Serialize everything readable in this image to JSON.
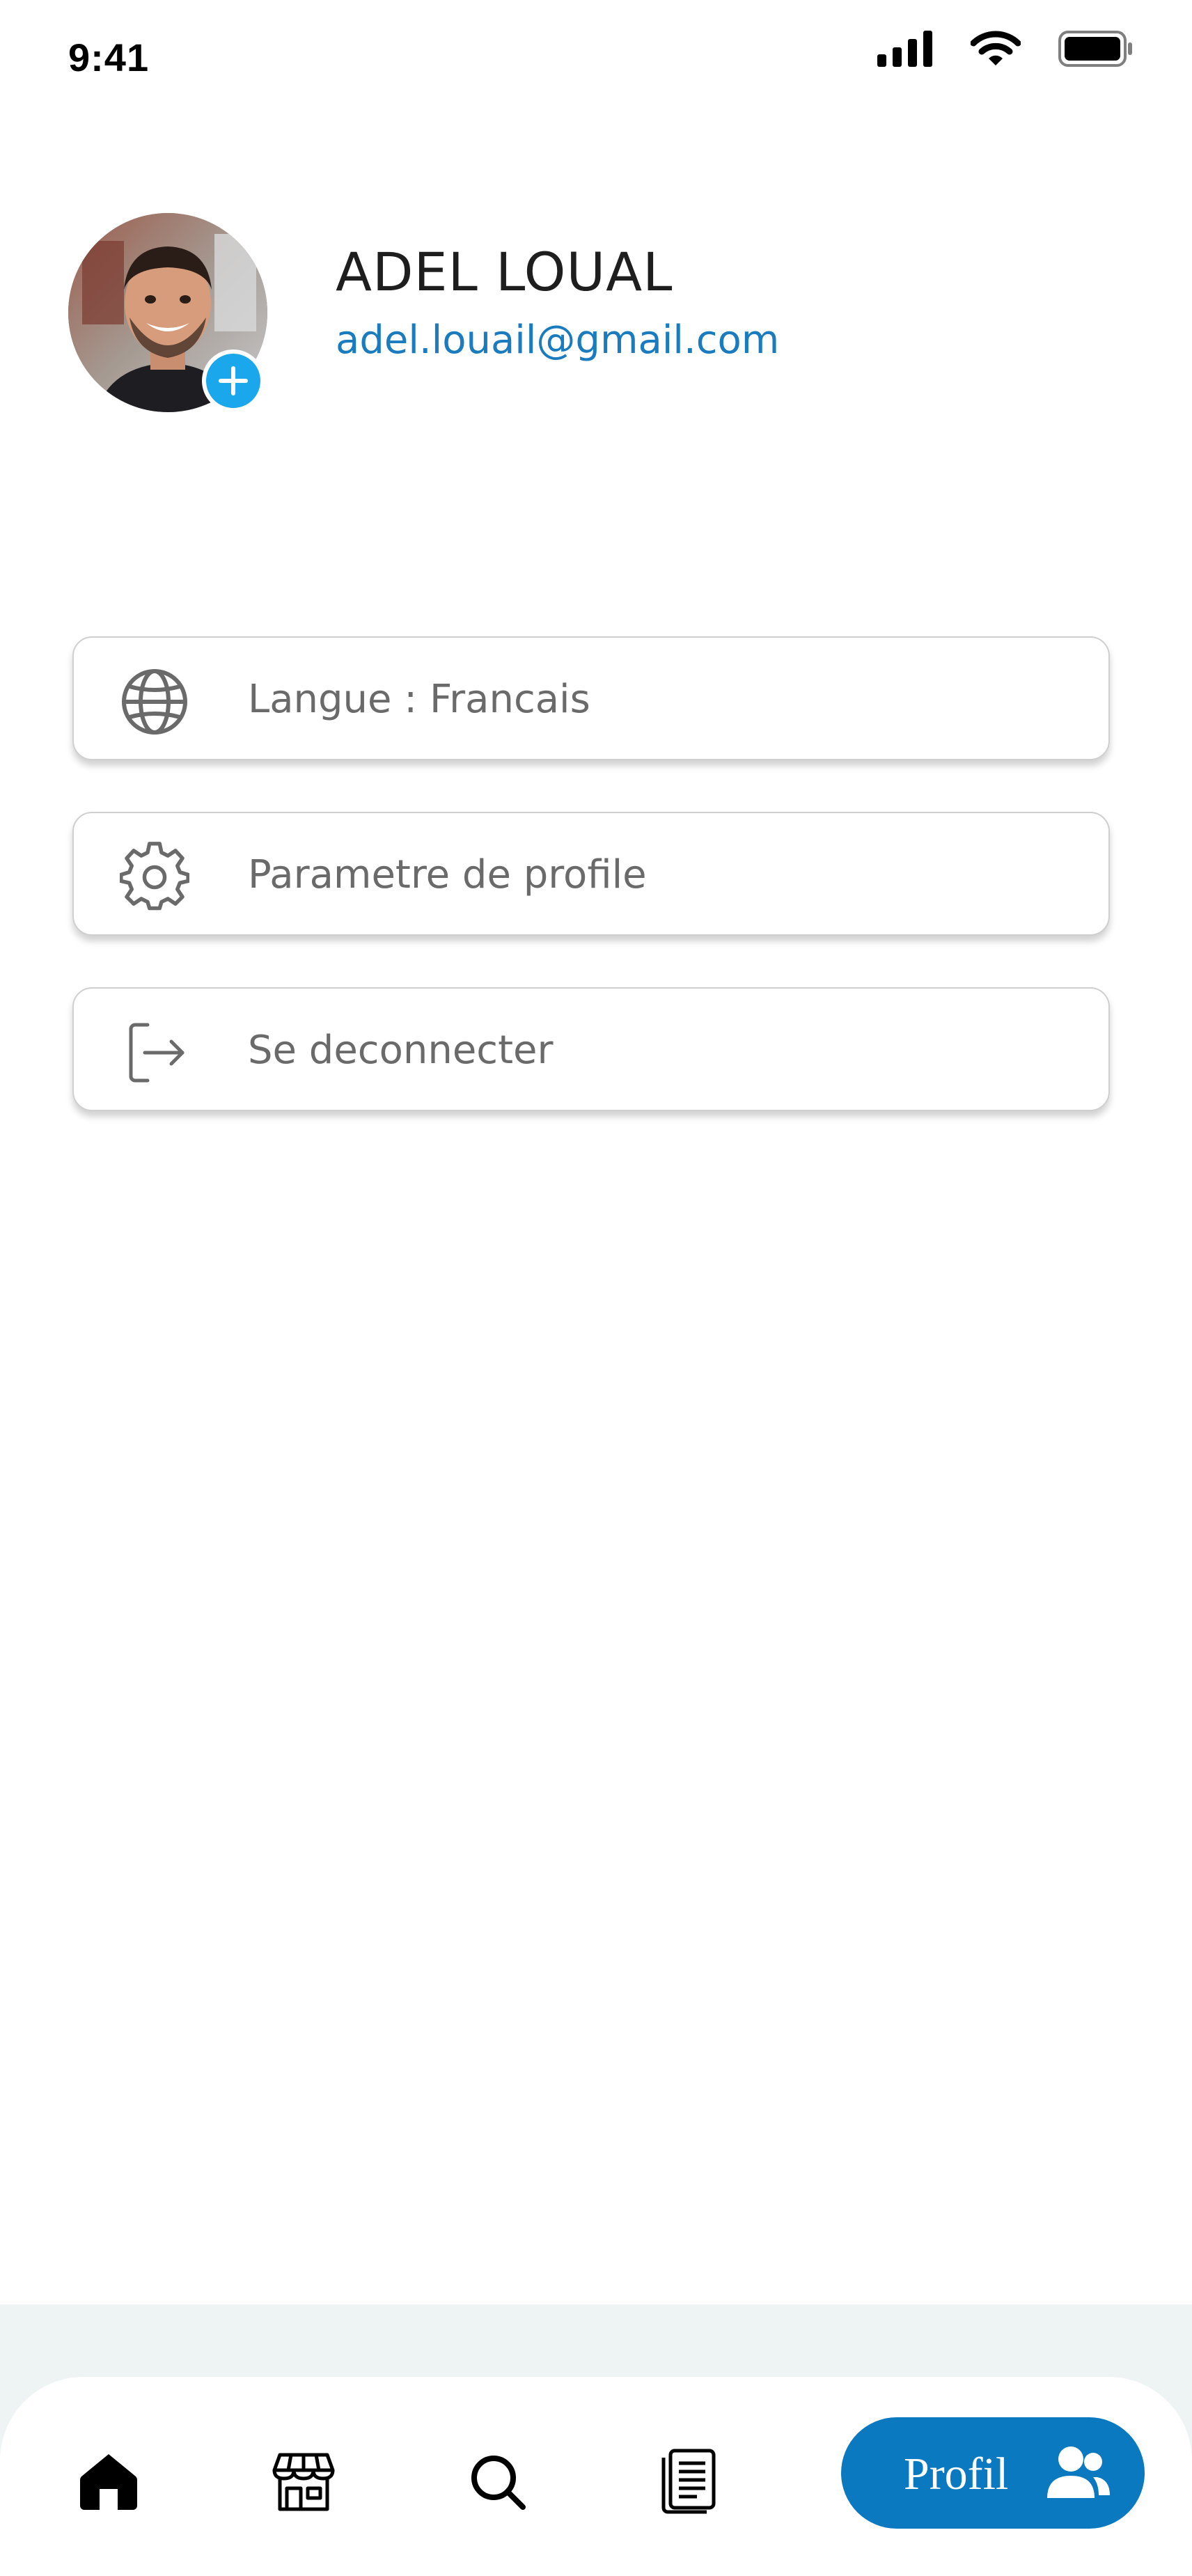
{
  "status_bar": {
    "time": "9:41"
  },
  "profile": {
    "name": "ADEL LOUAL",
    "email": "adel.louail@gmail.com"
  },
  "menu": {
    "items": [
      {
        "label": "Langue : Francais",
        "icon": "globe-icon"
      },
      {
        "label": "Parametre de profile",
        "icon": "gear-icon"
      },
      {
        "label": "Se deconnecter",
        "icon": "logout-icon"
      }
    ]
  },
  "bottom_nav": {
    "items": [
      {
        "icon": "home-icon",
        "active": false
      },
      {
        "icon": "store-icon",
        "active": false
      },
      {
        "icon": "search-icon",
        "active": false
      },
      {
        "icon": "document-icon",
        "active": false
      }
    ],
    "active": {
      "label": "Profil",
      "icon": "users-icon"
    }
  },
  "colors": {
    "accent": "#0a79c0",
    "email": "#1a7bbf",
    "add_badge": "#1aa7ec",
    "menu_text": "#6a6a6a",
    "nav_backdrop": "#eef3f4"
  }
}
